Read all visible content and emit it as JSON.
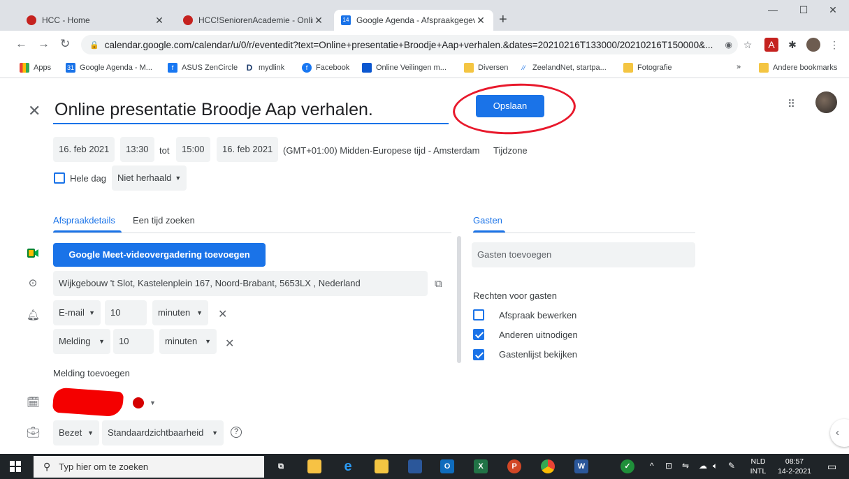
{
  "browser": {
    "tabs": [
      {
        "title": "HCC - Home"
      },
      {
        "title": "HCC!SeniorenAcademie - Online"
      },
      {
        "title": "Google Agenda - Afspraakgegev"
      }
    ],
    "address": "calendar.google.com/calendar/u/0/r/eventedit?text=Online+presentatie+Broodje+Aap+verhalen.&dates=20210216T133000/20210216T150000&...",
    "bookmarks": [
      {
        "label": "Apps"
      },
      {
        "label": "Google Agenda - M..."
      },
      {
        "label": "ASUS ZenCircle"
      },
      {
        "label": "mydlink"
      },
      {
        "label": "Facebook"
      },
      {
        "label": "Online Veilingen m..."
      },
      {
        "label": "Diversen"
      },
      {
        "label": "ZeelandNet, startpa..."
      },
      {
        "label": "Fotografie"
      }
    ],
    "bookmarks_more": "»",
    "other_bookmarks": "Andere bookmarks"
  },
  "event": {
    "title": "Online presentatie Broodje Aap verhalen.",
    "save_label": "Opslaan",
    "start_date": "16. feb 2021",
    "start_time": "13:30",
    "to_label": "tot",
    "end_time": "15:00",
    "end_date": "16. feb 2021",
    "timezone": "(GMT+01:00) Midden-Europese tijd - Amsterdam",
    "timezone_link": "Tijdzone",
    "all_day_label": "Hele dag",
    "repeat": "Niet herhaald",
    "tabs": [
      "Afspraakdetails",
      "Een tijd zoeken"
    ],
    "meet_button": "Google Meet-videovergadering toevoegen",
    "location": "Wijkgebouw 't Slot, Kastelenplein 167, Noord-Brabant, 5653LX , Nederland",
    "notifications": [
      {
        "type": "E-mail",
        "amount": "10",
        "unit": "minuten"
      },
      {
        "type": "Melding",
        "amount": "10",
        "unit": "minuten"
      }
    ],
    "add_notification": "Melding toevoegen",
    "busy": "Bezet",
    "visibility": "Standaardzichtbaarheid",
    "help": "?"
  },
  "guests": {
    "heading": "Gasten",
    "add_placeholder": "Gasten toevoegen",
    "permissions_heading": "Rechten voor gasten",
    "permissions": [
      {
        "label": "Afspraak bewerken",
        "checked": false
      },
      {
        "label": "Anderen uitnodigen",
        "checked": true
      },
      {
        "label": "Gastenlijst bekijken",
        "checked": true
      }
    ]
  },
  "taskbar": {
    "search_placeholder": "Typ hier om te zoeken",
    "lang_top": "NLD",
    "lang_bottom": "INTL",
    "time": "08:57",
    "date": "14-2-2021"
  },
  "colors": {
    "accent": "#1a73e8",
    "annotation": "#e8192c",
    "calendar_color": "#d50000"
  }
}
